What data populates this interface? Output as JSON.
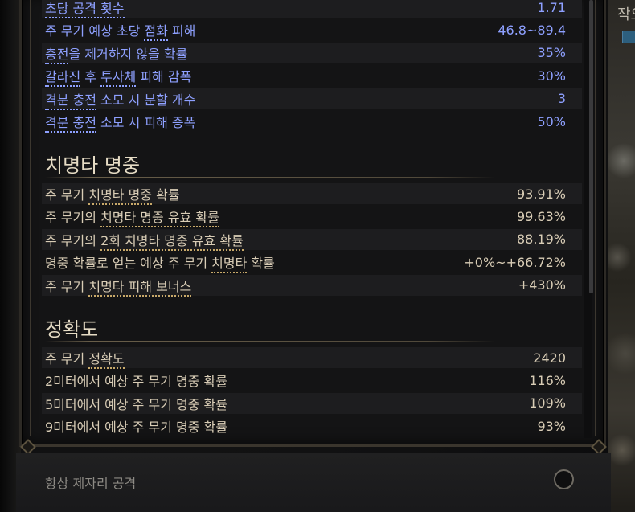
{
  "right_edge_text": "작오",
  "weapon_stats": {
    "rows": [
      {
        "label_parts": [
          {
            "t": "초당 공격 횟수",
            "kw": true
          }
        ],
        "value": "1.71"
      },
      {
        "label_parts": [
          {
            "t": "주 무기 예상 초당 "
          },
          {
            "t": "점화",
            "kw": true
          },
          {
            "t": " 피해"
          }
        ],
        "value": "46.8~89.4"
      },
      {
        "label_parts": [
          {
            "t": "충전",
            "kw": true
          },
          {
            "t": "을 제거하지 않을 확률"
          }
        ],
        "value": "35%"
      },
      {
        "label_parts": [
          {
            "t": "갈라진",
            "kw": true
          },
          {
            "t": " 후 "
          },
          {
            "t": "투사체",
            "kw": true
          },
          {
            "t": " 피해 감폭"
          }
        ],
        "value": "30%"
      },
      {
        "label_parts": [
          {
            "t": "격분 충전",
            "kw": true
          },
          {
            "t": " 소모 시 분할 개수"
          }
        ],
        "value": "3"
      },
      {
        "label_parts": [
          {
            "t": "격분 충전",
            "kw": true
          },
          {
            "t": " 소모 시 피해 증폭"
          }
        ],
        "value": "50%"
      }
    ]
  },
  "crit_section": {
    "title": "치명타 명중",
    "rows": [
      {
        "label_parts": [
          {
            "t": "주 무기 "
          },
          {
            "t": "치명타 명중",
            "kw": true
          },
          {
            "t": " 확률"
          }
        ],
        "value": "93.91%"
      },
      {
        "label_parts": [
          {
            "t": "주 무기의 "
          },
          {
            "t": "치명타 명중 유효 확률",
            "kw": true
          }
        ],
        "value": "99.63%"
      },
      {
        "label_parts": [
          {
            "t": "주 무기의 "
          },
          {
            "t": "2회 치명타 명중 유효 확률",
            "kw": true
          }
        ],
        "value": "88.19%"
      },
      {
        "label_parts": [
          {
            "t": "명중 확률로 얻는 예상 주 무기 "
          },
          {
            "t": "치명타",
            "kw": true
          },
          {
            "t": " 확률"
          }
        ],
        "value": "+0%~+66.72%"
      },
      {
        "label_parts": [
          {
            "t": "주 무기 "
          },
          {
            "t": "치명타 피해 보너스",
            "kw": true
          }
        ],
        "value": "+430%"
      }
    ]
  },
  "accuracy_section": {
    "title": "정확도",
    "rows": [
      {
        "label_parts": [
          {
            "t": "주 무기 "
          },
          {
            "t": "정확도",
            "kw": true
          }
        ],
        "value": "2420"
      },
      {
        "label_parts": [
          {
            "t": "2미터에서 예상 주 무기 명중 확률"
          }
        ],
        "value": "116%"
      },
      {
        "label_parts": [
          {
            "t": "5미터에서 예상 주 무기 명중 확률"
          }
        ],
        "value": "109%"
      },
      {
        "label_parts": [
          {
            "t": "9미터에서 예상 주 무기 명중 확률"
          }
        ],
        "value": "93%"
      }
    ]
  },
  "bottom_option": {
    "label": "항상 제자리 공격",
    "checked": false
  },
  "colors": {
    "blue_text": "#8ea0ff",
    "gold_text": "#d9cdb6",
    "title_text": "#e6dcc5",
    "keyword_underline": "#c8a96a"
  }
}
